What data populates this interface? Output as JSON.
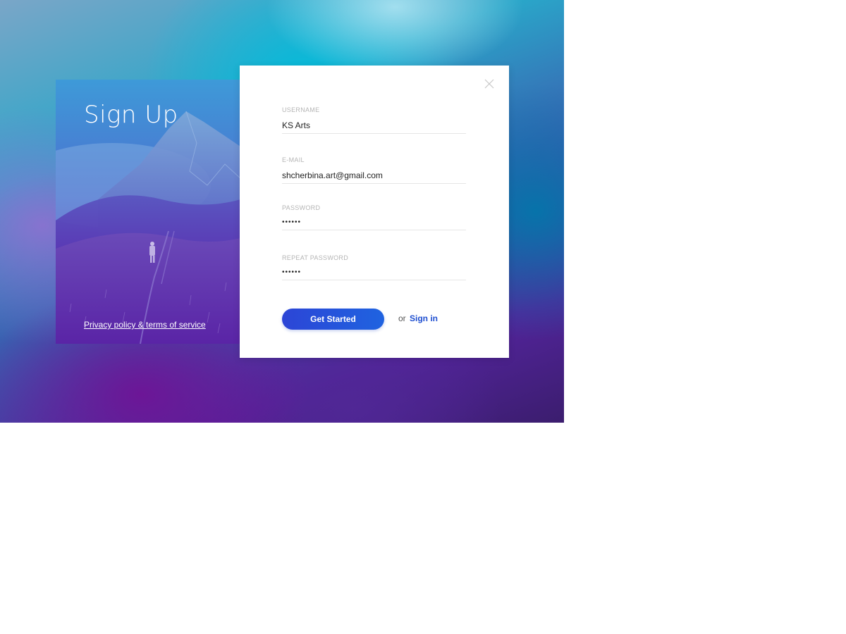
{
  "left_panel": {
    "title": "Sign Up",
    "privacy_link": "Privacy policy & terms of service"
  },
  "form": {
    "fields": [
      {
        "label": "USERNAME",
        "value": "KS Arts",
        "type": "text"
      },
      {
        "label": "E-MAIL",
        "value": "shcherbina.art@gmail.com",
        "type": "email"
      },
      {
        "label": "PASSWORD",
        "value": "••••••",
        "type": "password"
      },
      {
        "label": "REPEAT PASSWORD",
        "value": "••••••",
        "type": "password"
      }
    ],
    "submit_label": "Get Started",
    "alt_prefix": "or",
    "alt_link": "Sign in"
  },
  "icons": {
    "close": "close-icon",
    "background": "mountain-landscape-image"
  },
  "colors": {
    "primary": "#1f4fd0",
    "button_start": "#2c45d6",
    "button_end": "#1f63e0",
    "label": "#b5b5b5"
  }
}
